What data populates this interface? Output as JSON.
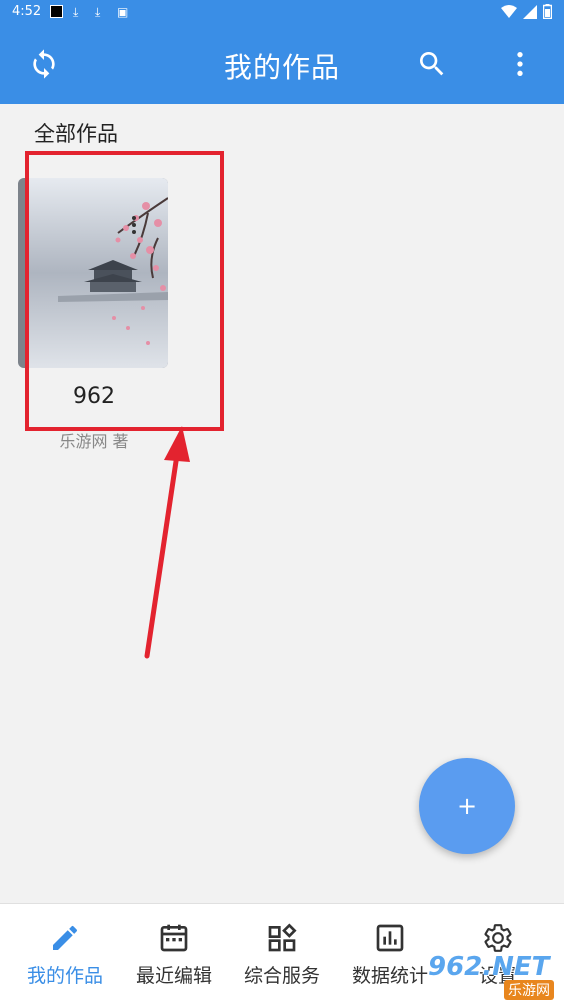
{
  "status": {
    "time": "4:52"
  },
  "appbar": {
    "title": "我的作品"
  },
  "section": {
    "title": "全部作品"
  },
  "book": {
    "title": "962",
    "author": "乐游网 著"
  },
  "fab": {
    "label": "+"
  },
  "nav": {
    "items": [
      {
        "label": "我的作品",
        "icon": "pencil-icon",
        "active": true
      },
      {
        "label": "最近编辑",
        "icon": "calendar-icon",
        "active": false
      },
      {
        "label": "综合服务",
        "icon": "grid-icon",
        "active": false
      },
      {
        "label": "数据统计",
        "icon": "bar-chart-icon",
        "active": false
      },
      {
        "label": "设置",
        "icon": "gear-icon",
        "active": false
      }
    ]
  },
  "watermark": {
    "brand": "962.NET",
    "sub": "乐游网"
  },
  "colors": {
    "primary": "#3a8ee6",
    "fab": "#5a9cf0",
    "annotation": "#e3232f"
  }
}
